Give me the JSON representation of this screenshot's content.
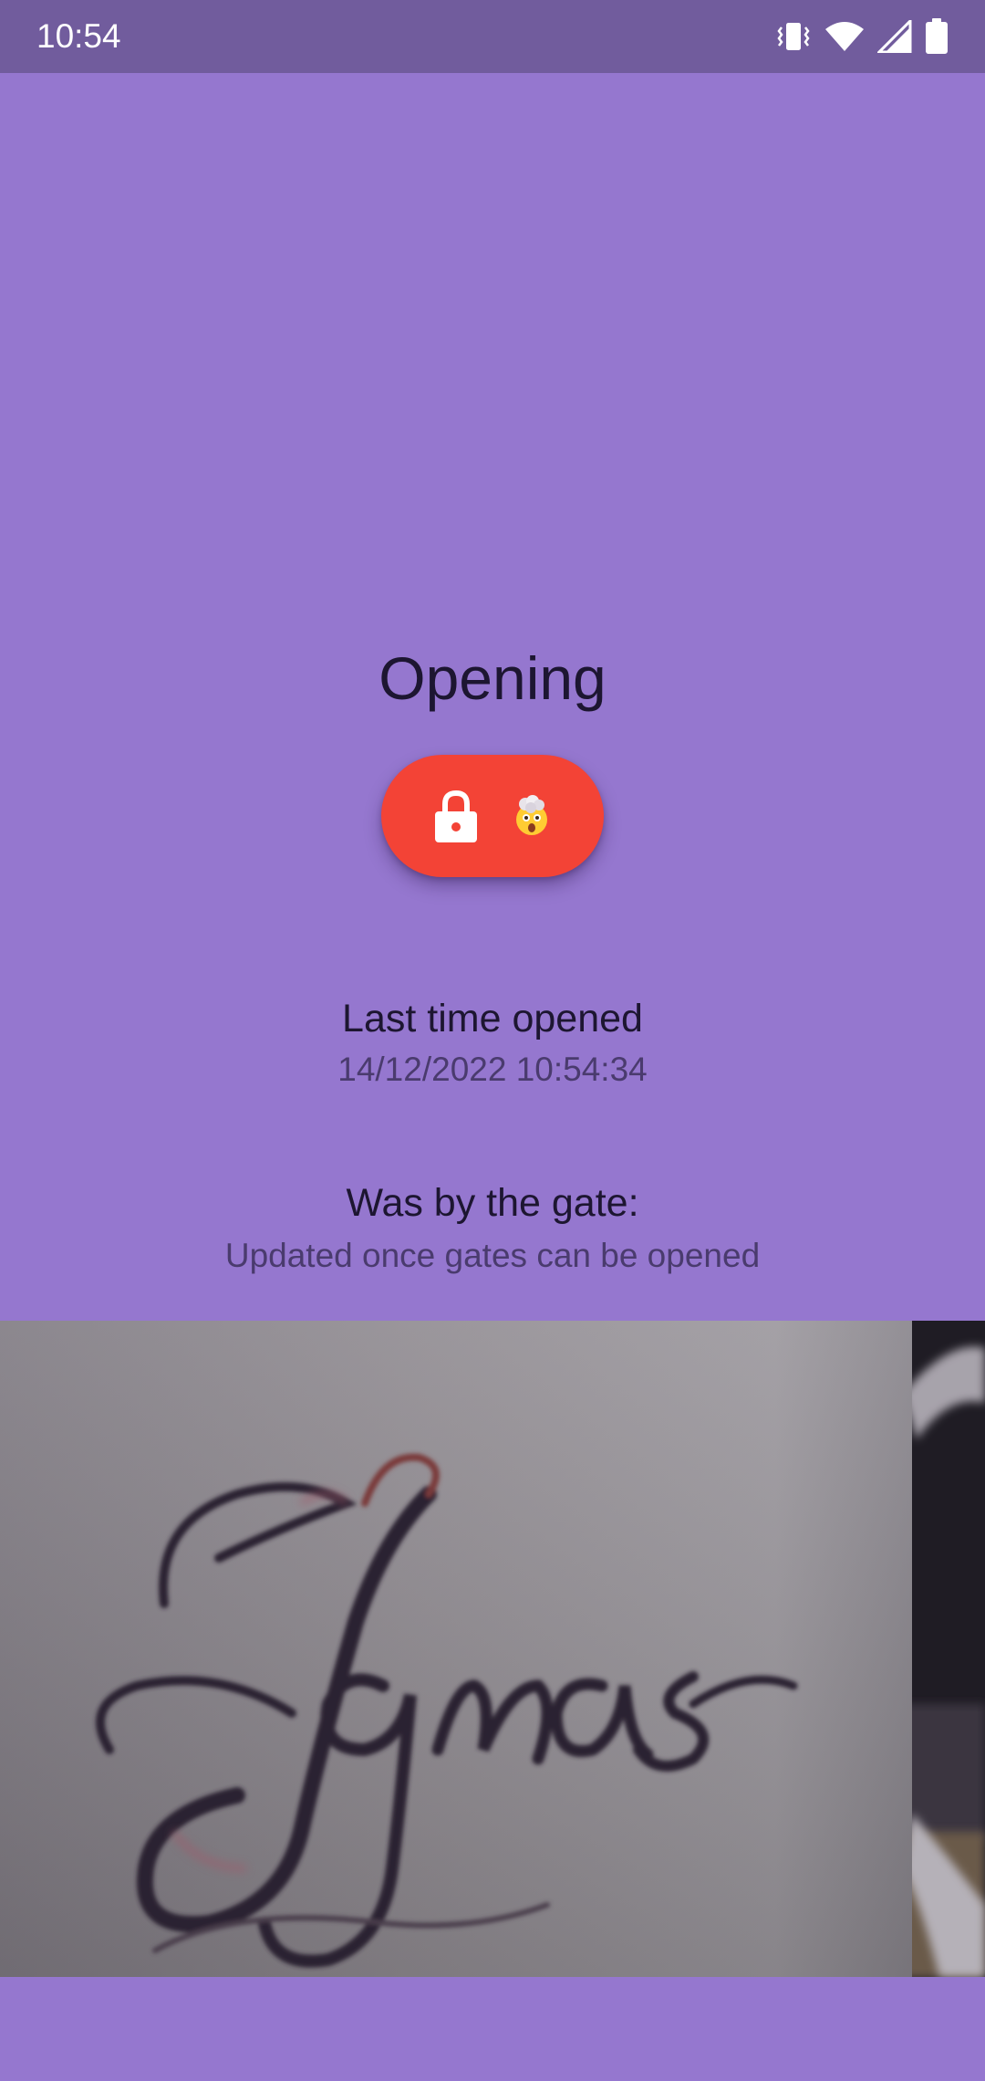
{
  "status_bar": {
    "time": "10:54",
    "icons": [
      "vibrate-icon",
      "wifi-icon",
      "signal-icon",
      "battery-icon"
    ]
  },
  "main": {
    "title": "Opening",
    "gate_button": {
      "icons": [
        "lock-icon",
        "exploding-head-emoji-icon"
      ],
      "color": "#f34336"
    },
    "last_opened": {
      "label": "Last time opened",
      "value": "14/12/2022 10:54:34"
    },
    "gate": {
      "label": "Was by the gate:",
      "subtext": "Updated once gates can be opened"
    },
    "camera_image": {
      "description_icon": "camera-snapshot-image"
    }
  },
  "colors": {
    "background": "#9577cf",
    "status_bar": "#715c9d",
    "accent": "#f34336",
    "text_primary": "#1d1631",
    "text_secondary": "#4a3b6e"
  }
}
